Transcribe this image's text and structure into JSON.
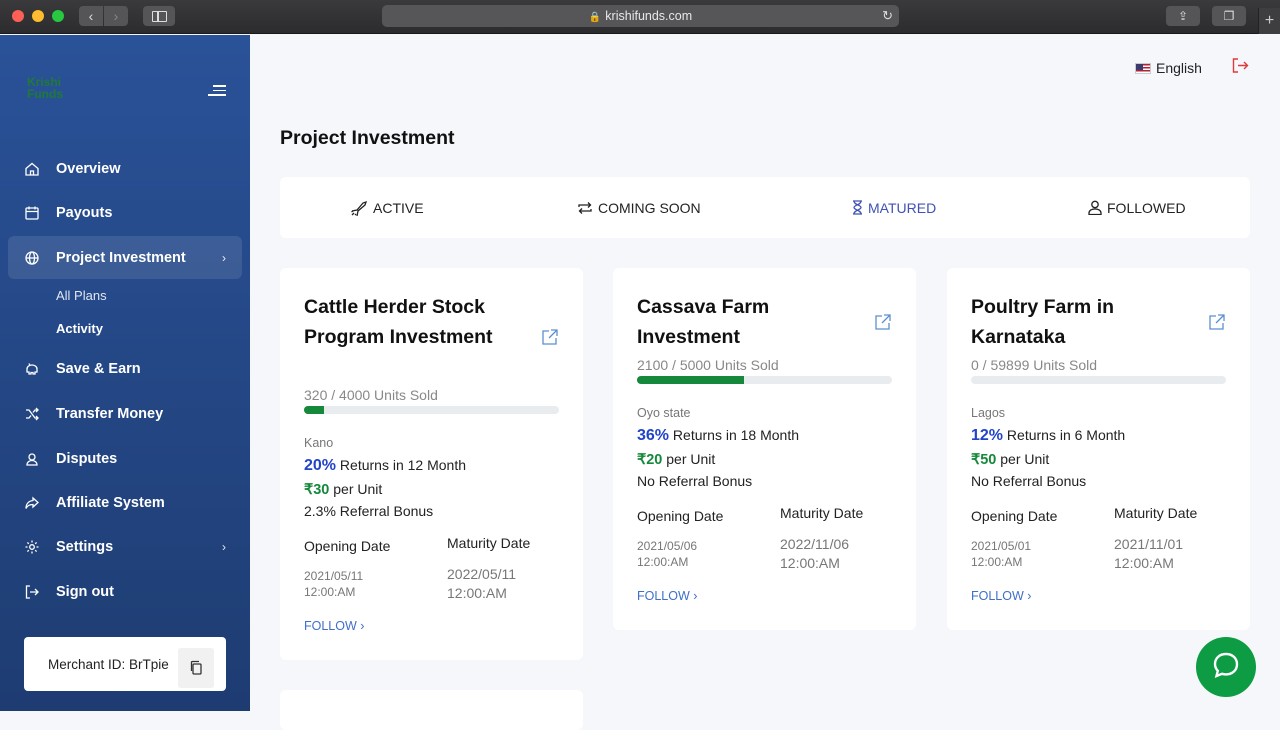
{
  "browser": {
    "url": "krishifunds.com"
  },
  "logo": {
    "line1": "Krishi",
    "line2": "Funds"
  },
  "sidebar": {
    "items": [
      {
        "label": "Overview"
      },
      {
        "label": "Payouts"
      },
      {
        "label": "Project Investment"
      },
      {
        "label": "Save & Earn"
      },
      {
        "label": "Transfer Money"
      },
      {
        "label": "Disputes"
      },
      {
        "label": "Affiliate System"
      },
      {
        "label": "Settings"
      },
      {
        "label": "Sign out"
      }
    ],
    "submenu": [
      {
        "label": "All Plans"
      },
      {
        "label": "Activity"
      }
    ],
    "merchant_id": "Merchant ID: BrTpie"
  },
  "header": {
    "language": "English"
  },
  "page": {
    "title": "Project Investment"
  },
  "tabs": [
    {
      "label": "ACTIVE"
    },
    {
      "label": "COMING SOON"
    },
    {
      "label": "MATURED"
    },
    {
      "label": "FOLLOWED"
    }
  ],
  "cards": [
    {
      "title": "Cattle Herder Stock Program Investment",
      "units": "320 / 4000 Units Sold",
      "progress": 0.08,
      "location": "Kano",
      "returns_pct": "20%",
      "returns_text": "Returns in 12 Month",
      "price": "₹30",
      "price_text": "per Unit",
      "bonus": "2.3% Referral Bonus",
      "opening_label": "Opening Date",
      "opening_date": "2021/05/11",
      "opening_time": "12:00:AM",
      "maturity_label": "Maturity Date",
      "maturity_date": "2022/05/11",
      "maturity_time": "12:00:AM",
      "follow": "FOLLOW"
    },
    {
      "title": "Cassava Farm Investment",
      "units": "2100 / 5000 Units Sold",
      "progress": 0.42,
      "location": "Oyo state",
      "returns_pct": "36%",
      "returns_text": "Returns in 18 Month",
      "price": "₹20",
      "price_text": "per Unit",
      "bonus": "No Referral Bonus",
      "opening_label": "Opening Date",
      "opening_date": "2021/05/06",
      "opening_time": "12:00:AM",
      "maturity_label": "Maturity Date",
      "maturity_date": "2022/11/06",
      "maturity_time": "12:00:AM",
      "follow": "FOLLOW"
    },
    {
      "title": "Poultry Farm in Karnataka",
      "units": "0 / 59899 Units Sold",
      "progress": 0,
      "location": "Lagos",
      "returns_pct": "12%",
      "returns_text": "Returns in 6 Month",
      "price": "₹50",
      "price_text": "per Unit",
      "bonus": "No Referral Bonus",
      "opening_label": "Opening Date",
      "opening_date": "2021/05/01",
      "opening_time": "12:00:AM",
      "maturity_label": "Maturity Date",
      "maturity_date": "2021/11/01",
      "maturity_time": "12:00:AM",
      "follow": "FOLLOW"
    }
  ]
}
